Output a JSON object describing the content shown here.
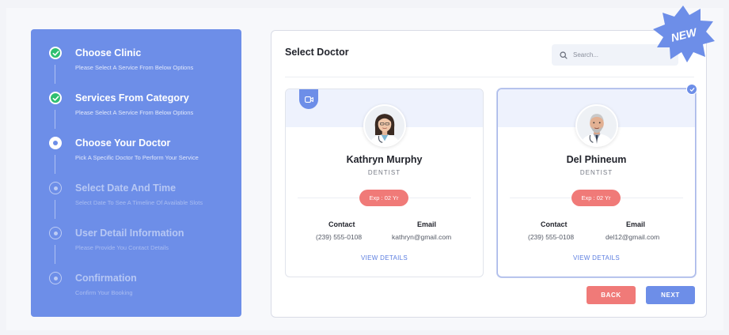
{
  "steps": [
    {
      "title": "Choose Clinic",
      "subtitle": "Please Select A Service From Below Options",
      "status": "done"
    },
    {
      "title": "Services From Category",
      "subtitle": "Please Select A Service From Below Options",
      "status": "done"
    },
    {
      "title": "Choose Your Doctor",
      "subtitle": "Pick A Specific Doctor To Perform Your Service",
      "status": "active"
    },
    {
      "title": "Select Date And Time",
      "subtitle": "Select Date To See A Timeline Of Available Slots",
      "status": "pending"
    },
    {
      "title": "User Detail Information",
      "subtitle": "Please Provide You Contact Details",
      "status": "pending"
    },
    {
      "title": "Confirmation",
      "subtitle": "Confirm Your Booking",
      "status": "pending"
    }
  ],
  "panel": {
    "title": "Select Doctor",
    "search_placeholder": "Search..."
  },
  "badge": {
    "text": "NEW"
  },
  "doctors": [
    {
      "name": "Kathryn Murphy",
      "role": "DENTIST",
      "experience": "Exp : 02 Yr",
      "contact_label": "Contact",
      "contact": "(239) 555-0108",
      "email_label": "Email",
      "email": "kathryn@gmail.com",
      "view_label": "VIEW DETAILS",
      "video": true,
      "selected": false
    },
    {
      "name": "Del Phineum",
      "role": "DENTIST",
      "experience": "Exp : 02 Yr",
      "contact_label": "Contact",
      "contact": "(239) 555-0108",
      "email_label": "Email",
      "email": "del12@gmail.com",
      "view_label": "VIEW DETAILS",
      "video": false,
      "selected": true
    }
  ],
  "buttons": {
    "back": "BACK",
    "next": "NEXT"
  },
  "colors": {
    "primary": "#6d8ee8",
    "accent": "#f07a78",
    "done": "#2fbf71"
  }
}
